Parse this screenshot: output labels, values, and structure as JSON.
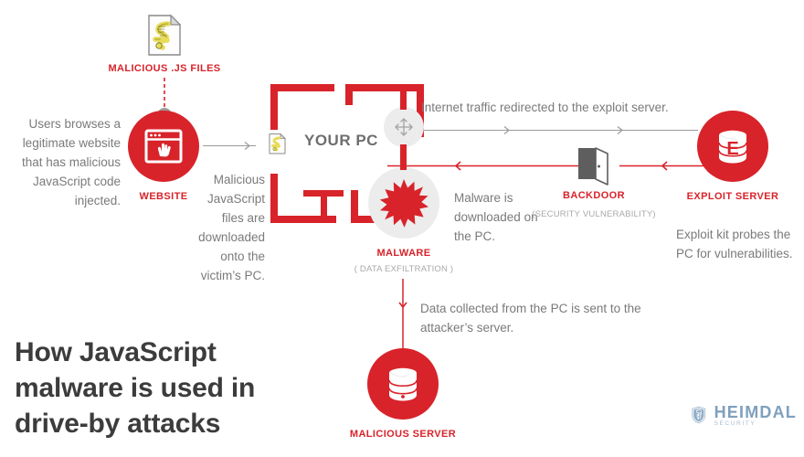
{
  "colors": {
    "brand_red": "#d8232a",
    "body_gray": "#7a7a7a",
    "sub_gray": "#a9a9a9",
    "headline_gray": "#3c3c3c",
    "line_gray": "#9a9a9a",
    "circle_gray": "#ececec",
    "logo_blue": "#7fa0bd",
    "js_icon_yellow": "#e8dc5a",
    "door_gray": "#5e5e5e"
  },
  "headline": {
    "line1": "How JavaScript",
    "line2": "malware is used in",
    "line3": "drive-by attacks"
  },
  "nodes": {
    "js_files": {
      "label": "MALICIOUS .JS FILES",
      "icon": "js-file-icon"
    },
    "website": {
      "label": "WEBSITE",
      "icon": "browser-window-click-icon"
    },
    "your_pc": {
      "label": "YOUR PC",
      "icon": "pc-bracket-frame"
    },
    "traffic": {
      "icon": "move-arrows-icon"
    },
    "malware": {
      "label": "MALWARE",
      "sublabel": "( DATA EXFILTRATION )",
      "icon": "starburst-icon"
    },
    "backdoor": {
      "label": "BACKDOOR",
      "sublabel": "(SECURITY VULNERABILITY)",
      "icon": "open-door-icon"
    },
    "exploit_server": {
      "label": "EXPLOIT SERVER",
      "icon": "database-e-icon",
      "glyph": "E"
    },
    "malicious_server": {
      "label": "MALICIOUS SERVER",
      "icon": "database-icon"
    },
    "pc_js_file": {
      "icon": "js-file-small-icon"
    }
  },
  "captions": {
    "users_browse": "Users browses a legitimate website that has malicious JavaScript code injected.",
    "files_downloaded": "Malicious JavaScript files are downloaded onto the victim’s PC.",
    "internet_traffic": "Internet traffic redirected to the exploit server.",
    "malware_downloaded": "Malware is downloaded on the PC.",
    "exploit_probes": "Exploit kit probes the PC for vulnerabilities.",
    "data_collected": "Data collected from the PC is sent to the attacker’s server."
  },
  "logo": {
    "name": "HEIMDAL",
    "tagline": "SECURITY",
    "icon": "heimdal-shield-icon"
  }
}
